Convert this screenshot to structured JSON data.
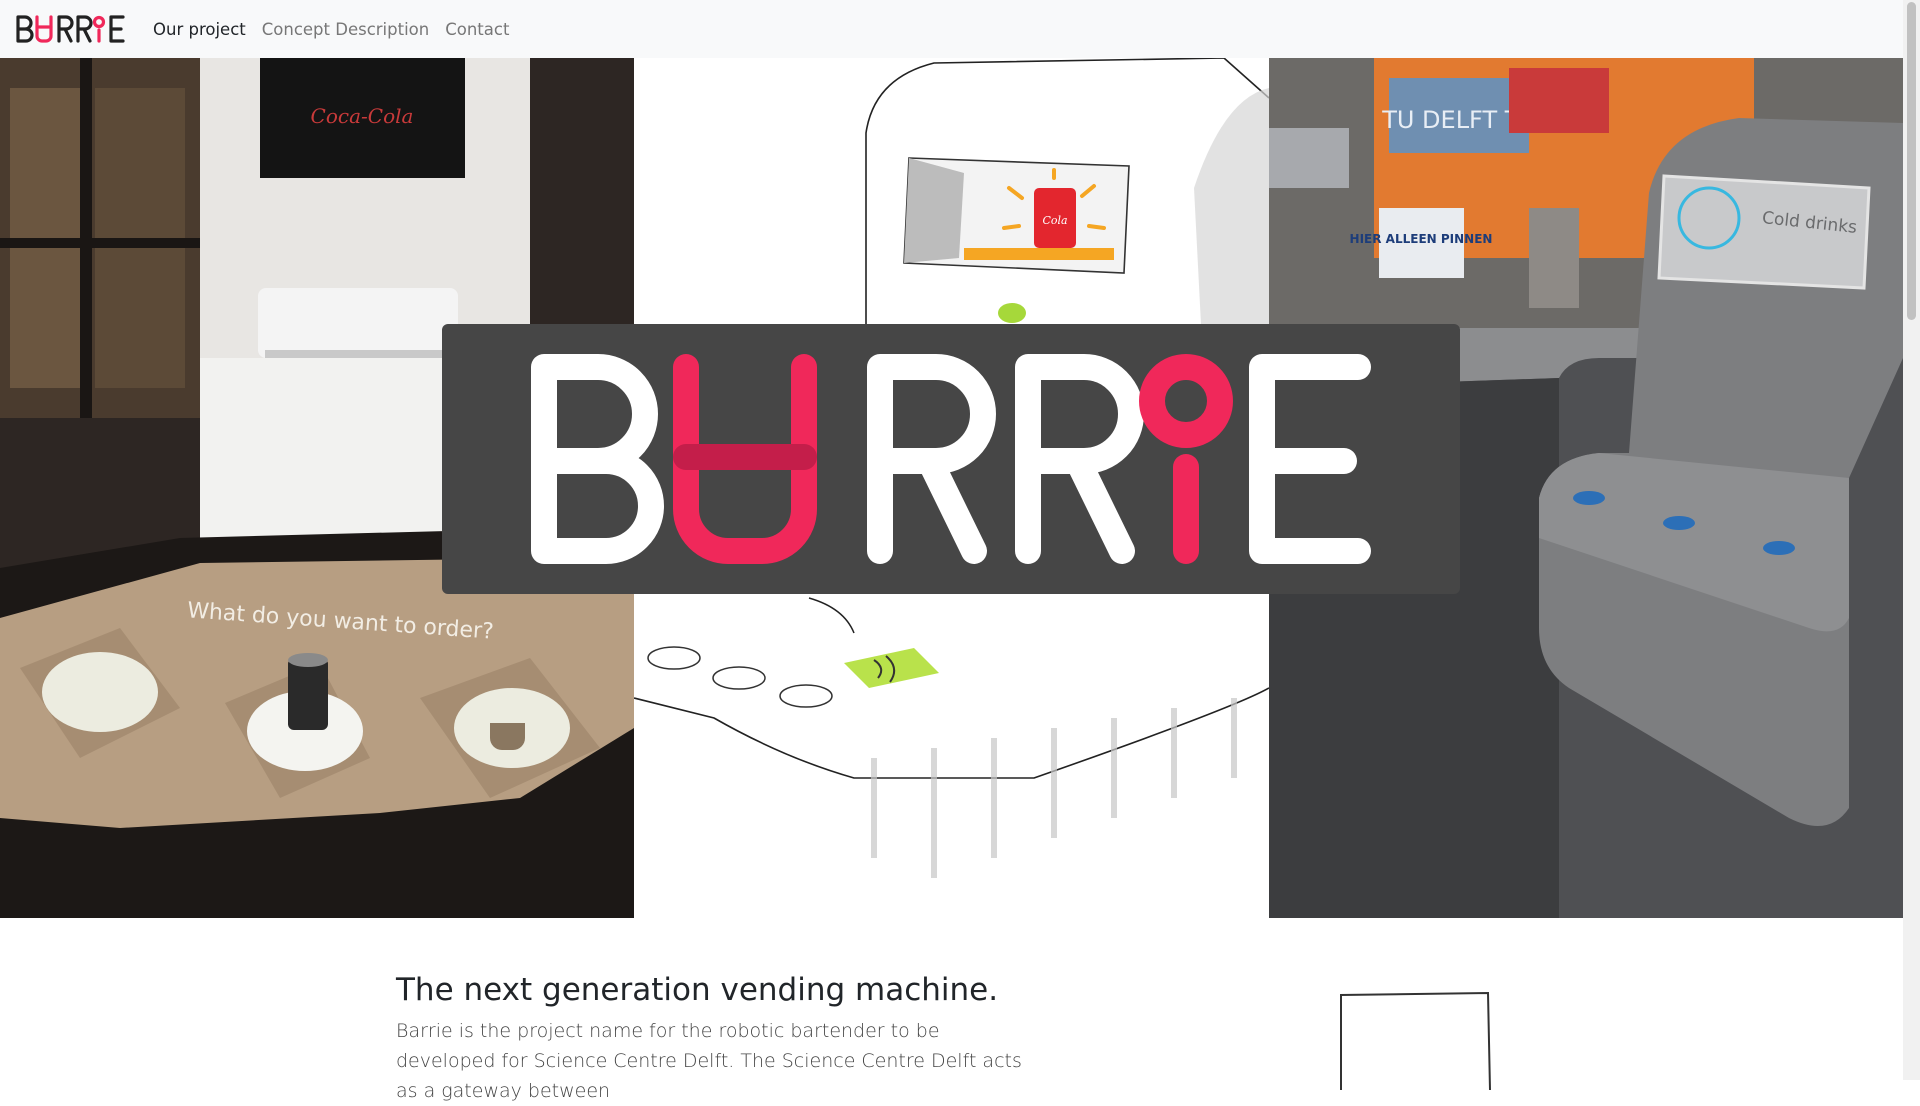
{
  "nav": {
    "brand": "BARRIE",
    "links": [
      {
        "label": "Our project",
        "active": true
      },
      {
        "label": "Concept Description",
        "active": false
      },
      {
        "label": "Contact",
        "active": false
      }
    ]
  },
  "hero": {
    "logo_text": "BARRIE",
    "photo_left": {
      "projection_text": "What do you want to order?",
      "poster_text": "Coca-Cola"
    },
    "sketch_middle": {
      "can_text": "Cola"
    },
    "render_right": {
      "screen_text": "Cold drinks",
      "sign_text": "HIER ALLEEN PINNEN",
      "banner_text": "TU DELFT TV"
    }
  },
  "content": {
    "headline": "The next generation vending machine.",
    "intro": "Barrie is the project name for the robotic bartender to be developed for Science Centre Delft. The Science Centre Delft acts as a gateway between"
  },
  "colors": {
    "accent": "#f0285a",
    "nav_bg": "#f8f9fa",
    "logo_box": "#464646"
  }
}
